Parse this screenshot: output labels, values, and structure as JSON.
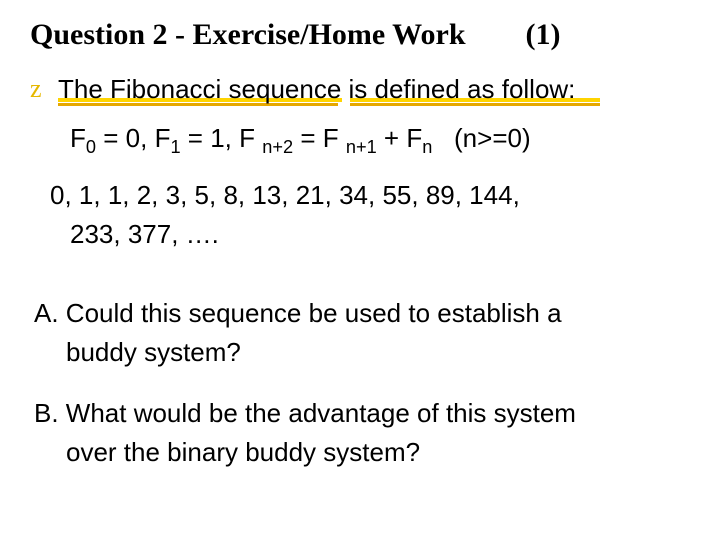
{
  "title": {
    "main": "Question 2 -  Exercise/Home Work",
    "page": "(1)"
  },
  "intro": "The Fibonacci sequence is defined as follow:",
  "formula": {
    "f0": "F",
    "sub0": "0",
    "eq0": " = 0, ",
    "f1": "F",
    "sub1": "1",
    "eq1": " = 1, F ",
    "subnp2": "n+2",
    "mid": " = F ",
    "subnp1": "n+1",
    "plus": " + F",
    "subn": "n",
    "cond": "   (n>=0)"
  },
  "sequence_line1": "0, 1, 1, 2, 3, 5, 8, 13, 21, 34, 55, 89, 144,",
  "sequence_line2": "233, 377, ….",
  "qa_line1": "A. Could this sequence be used to establish a",
  "qa_line2": "buddy system?",
  "qb_line1": "B. What would be the advantage of this system",
  "qb_line2": "over the binary buddy system?"
}
